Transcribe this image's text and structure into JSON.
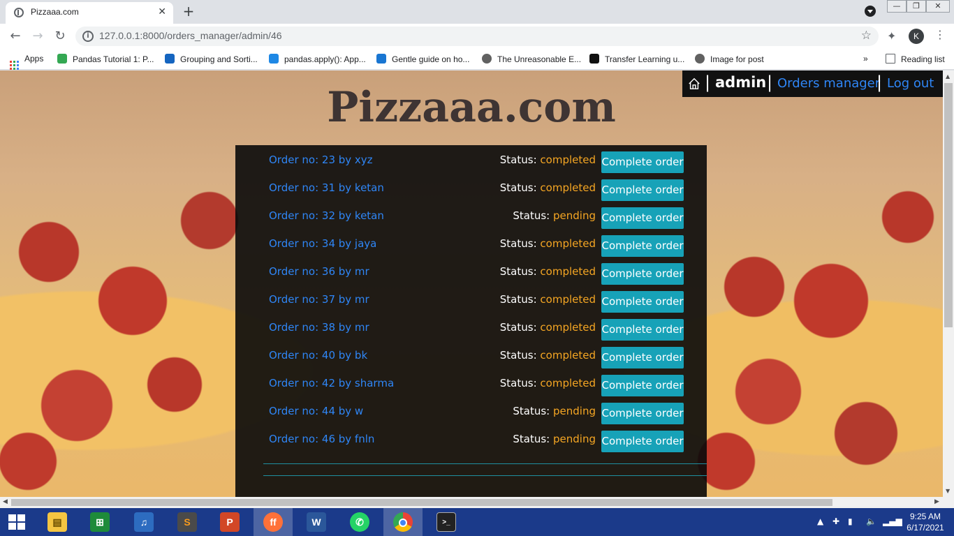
{
  "browser": {
    "tab_title": "Pizzaaa.com",
    "tab_close": "✕",
    "new_tab": "+",
    "url": "127.0.0.1:8000/orders_manager/admin/46",
    "profile_initial": "K",
    "window_buttons": [
      "—",
      "❐",
      "✕"
    ]
  },
  "bookmarks": {
    "items": [
      {
        "label": "Apps",
        "color": "#ea4335"
      },
      {
        "label": "Pandas Tutorial 1: P...",
        "color": "#34a853"
      },
      {
        "label": "Grouping and Sorti...",
        "color": "#1565c0"
      },
      {
        "label": "pandas.apply(): App...",
        "color": "#1e88e5"
      },
      {
        "label": "Gentle guide on ho...",
        "color": "#1976d2"
      },
      {
        "label": "The Unreasonable E...",
        "color": "#616161"
      },
      {
        "label": "Transfer Learning u...",
        "color": "#111111"
      },
      {
        "label": "Image for post",
        "color": "#616161"
      }
    ],
    "overflow": "»",
    "reading_list": "Reading list"
  },
  "page": {
    "site_title": "Pizzaaa.com",
    "nav": {
      "separator": "|",
      "admin": "admin",
      "orders_manager": "Orders manager",
      "logout": "Log out"
    },
    "status_label": "Status:",
    "complete_label": "Complete order",
    "orders": [
      {
        "text": "Order no: 23 by xyz",
        "status": "completed"
      },
      {
        "text": "Order no: 31 by ketan",
        "status": "completed"
      },
      {
        "text": "Order no: 32 by ketan",
        "status": "pending"
      },
      {
        "text": "Order no: 34 by jaya",
        "status": "completed"
      },
      {
        "text": "Order no: 36 by mr",
        "status": "completed"
      },
      {
        "text": "Order no: 37 by mr",
        "status": "completed"
      },
      {
        "text": "Order no: 38 by mr",
        "status": "completed"
      },
      {
        "text": "Order no: 40 by bk",
        "status": "completed"
      },
      {
        "text": "Order no: 42 by sharma",
        "status": "completed"
      },
      {
        "text": "Order no: 44 by w",
        "status": "pending"
      },
      {
        "text": "Order no: 46 by fnln",
        "status": "pending"
      }
    ],
    "colors": {
      "link": "#2f86f6",
      "status_value": "#f5a623",
      "button": "#17a2b8"
    }
  },
  "taskbar": {
    "apps": [
      "file-explorer",
      "store",
      "media-player",
      "sublime-text",
      "powerpoint",
      "firefox",
      "word",
      "whatsapp",
      "chrome",
      "terminal"
    ],
    "time": "9:25 AM",
    "date": "6/17/2021"
  }
}
